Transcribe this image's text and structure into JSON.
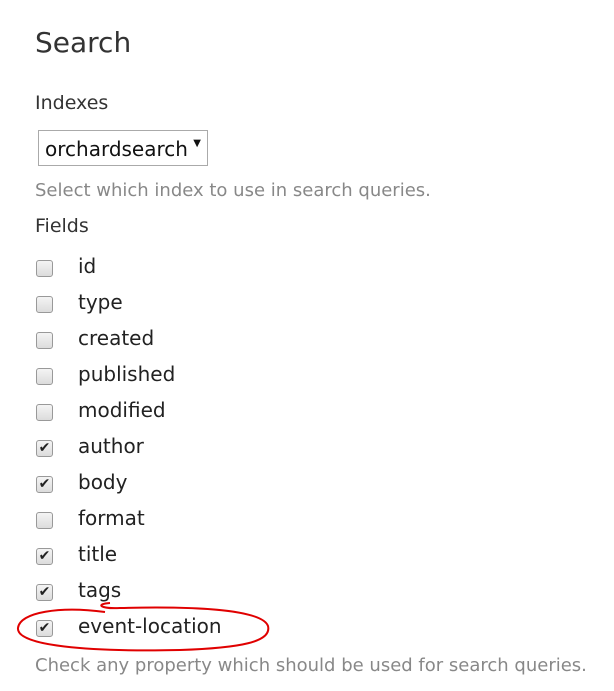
{
  "title": "Search",
  "indexes": {
    "label": "Indexes",
    "selected": "orchardsearch",
    "hint": "Select which index to use in search queries."
  },
  "fields": {
    "label": "Fields",
    "items": [
      {
        "name": "id",
        "checked": false
      },
      {
        "name": "type",
        "checked": false
      },
      {
        "name": "created",
        "checked": false
      },
      {
        "name": "published",
        "checked": false
      },
      {
        "name": "modified",
        "checked": false
      },
      {
        "name": "author",
        "checked": true
      },
      {
        "name": "body",
        "checked": true
      },
      {
        "name": "format",
        "checked": false
      },
      {
        "name": "title",
        "checked": true
      },
      {
        "name": "tags",
        "checked": true
      },
      {
        "name": "event-location",
        "checked": true
      }
    ],
    "hint": "Check any property which should be used for search queries."
  },
  "annotation_color": "#e00000"
}
